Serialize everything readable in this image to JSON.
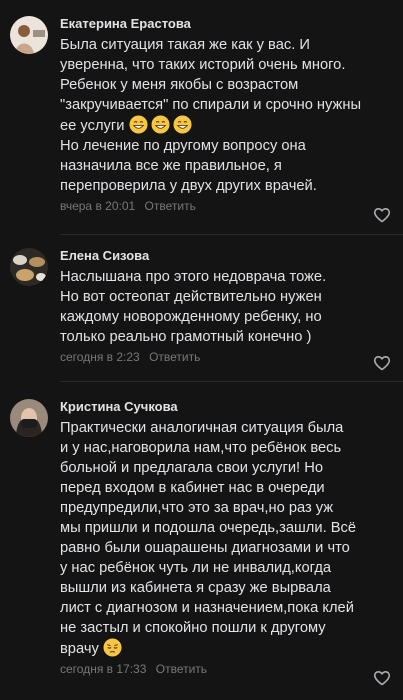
{
  "comments": [
    {
      "author": "Екатерина Ерастова",
      "lines": [
        "Была ситуация такая же как у вас. И",
        "уверенна, что таких историй очень много.",
        "Ребенок у меня якобы с возрастом",
        "\"закручивается\" по спирали и срочно нужны",
        "ее услуги",
        "Но лечение по другому вопросу она",
        "назначила все же правильное, я",
        "перепроверила у двух других врачей."
      ],
      "emojis": [
        "grinning-face-emoji",
        "grinning-face-emoji",
        "grinning-face-emoji"
      ],
      "time": "вчера в 20:01",
      "reply": "Ответить"
    },
    {
      "author": "Елена Сизова",
      "lines": [
        "Наслышана про этого недоврача тоже.",
        "Но вот остеопат действительно нужен",
        "каждому новорожденному ребенку, но",
        "только реально грамотный конечно )"
      ],
      "time": "сегодня в 2:23",
      "reply": "Ответить"
    },
    {
      "author": "Кристина Сучкова",
      "lines": [
        "Практически аналогичная ситуация была",
        "и у нас,наговорила нам,что ребёнок весь",
        "больной и предлагала свои услуги! Но",
        "перед входом в кабинет нас в очереди",
        "предупредили,что это за врач,но раз уж",
        "мы пришли и подошла очередь,зашли. Всё",
        "равно были ошарашены диагнозами и что",
        "у нас ребёнок чуть ли не инвалид,когда",
        "вышли из кабинета я сразу же вырвала",
        "лист с диагнозом и назначением,пока клей",
        "не застыл и спокойно пошли к другому",
        "врачу"
      ],
      "emojis": [
        "pensive-face-emoji"
      ],
      "time": "сегодня в 17:33",
      "reply": "Ответить"
    }
  ],
  "colors": {
    "background": "#141414",
    "text": "#e1e3e6",
    "secondary": "#76787a",
    "emoji": "#f7c643"
  }
}
